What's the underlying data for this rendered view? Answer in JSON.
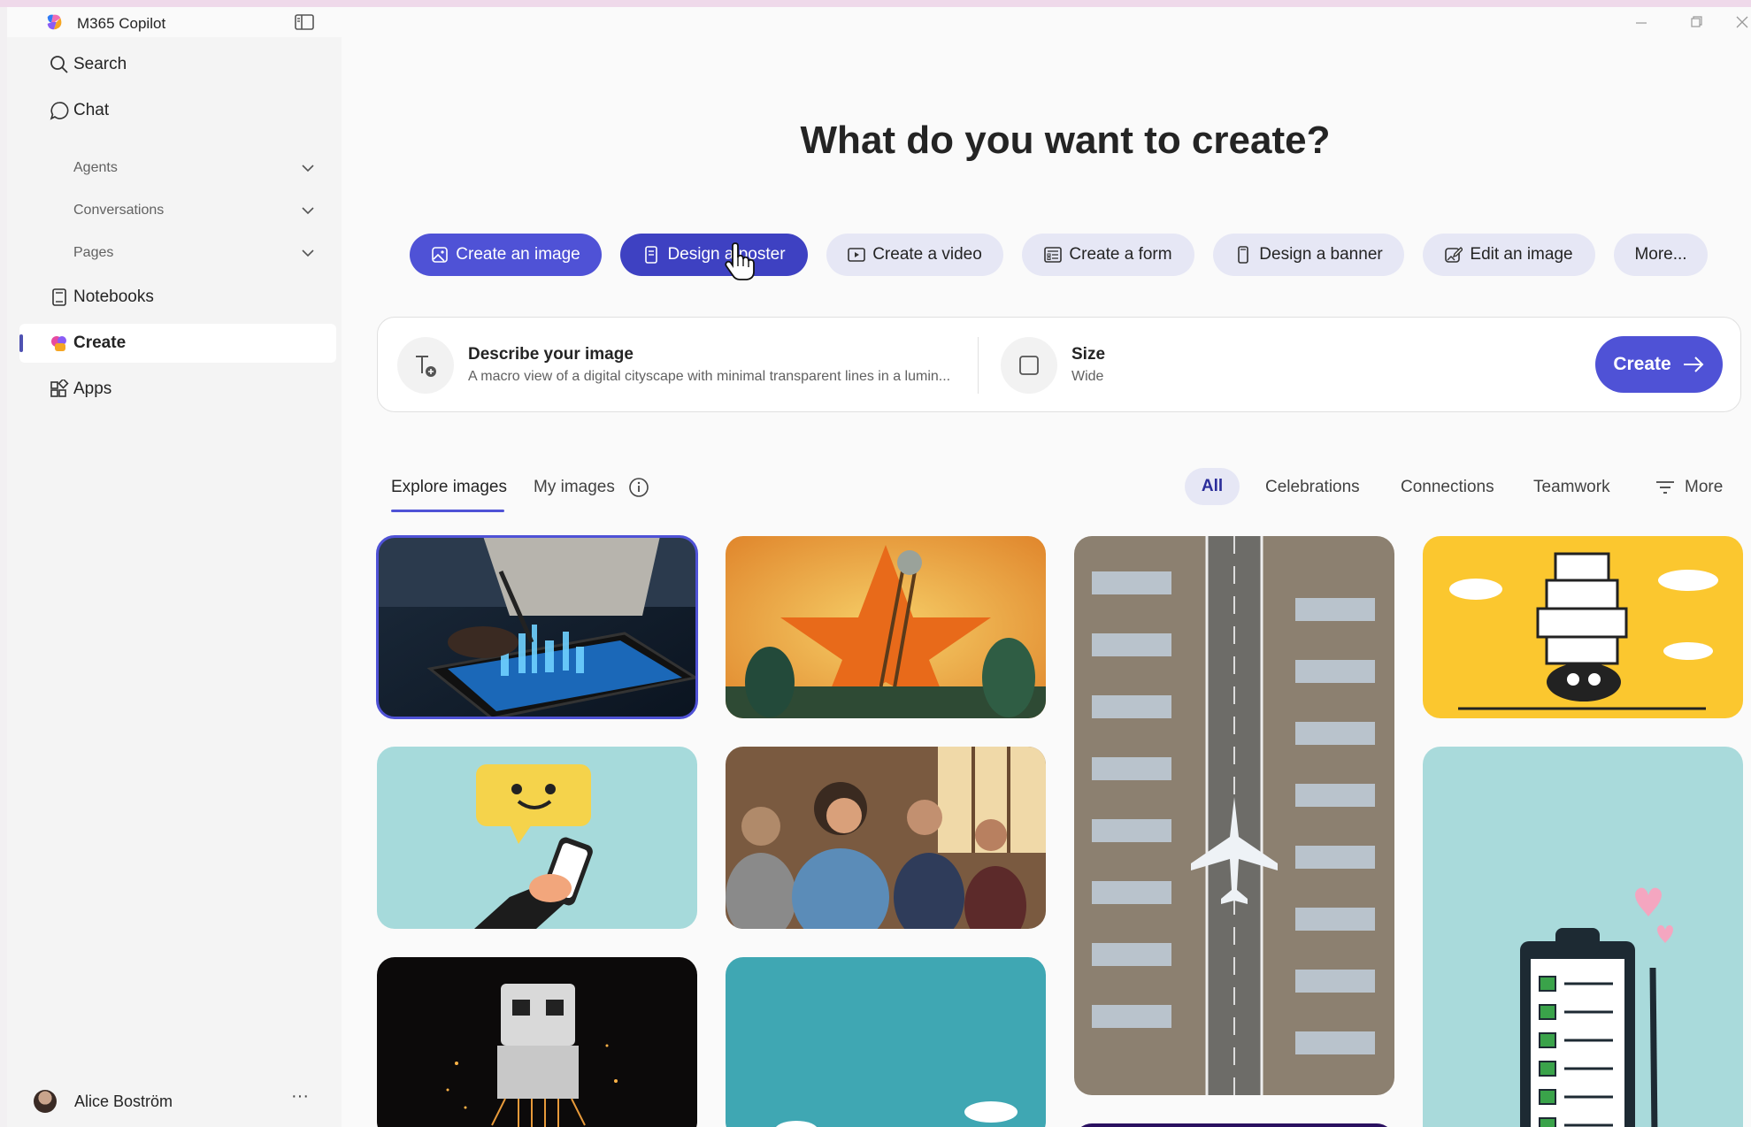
{
  "titlebar": {
    "app_title": "M365 Copilot"
  },
  "sidebar": {
    "items": [
      {
        "label": "Search",
        "icon": "search-icon"
      },
      {
        "label": "Chat",
        "icon": "chat-icon"
      },
      {
        "label": "Notebooks",
        "icon": "notebook-icon"
      },
      {
        "label": "Create",
        "icon": "create-icon",
        "active": true
      },
      {
        "label": "Apps",
        "icon": "apps-icon"
      }
    ],
    "subitems": [
      {
        "label": "Agents"
      },
      {
        "label": "Conversations"
      },
      {
        "label": "Pages"
      }
    ],
    "user": {
      "name": "Alice Boström",
      "more": "···"
    }
  },
  "main": {
    "heading": "What do you want to create?",
    "actions": [
      {
        "label": "Create an image",
        "icon": "image-icon"
      },
      {
        "label": "Design a poster",
        "icon": "poster-icon"
      },
      {
        "label": "Create a video",
        "icon": "video-icon"
      },
      {
        "label": "Create a form",
        "icon": "form-icon"
      },
      {
        "label": "Design a banner",
        "icon": "banner-icon"
      },
      {
        "label": "Edit an image",
        "icon": "edit-image-icon"
      },
      {
        "label": "More..."
      }
    ],
    "prompt": {
      "title": "Describe your image",
      "text": "A macro view of a digital cityscape with minimal transparent lines in a lumin...",
      "size_title": "Size",
      "size_value": "Wide",
      "create_label": "Create"
    },
    "tabs": {
      "explore": "Explore images",
      "mine": "My images"
    },
    "filters": {
      "all": "All",
      "celebrations": "Celebrations",
      "connections": "Connections",
      "teamwork": "Teamwork",
      "more": "More"
    }
  },
  "colors": {
    "accent": "#4f52d6",
    "accent_light": "#e6e7f5"
  }
}
